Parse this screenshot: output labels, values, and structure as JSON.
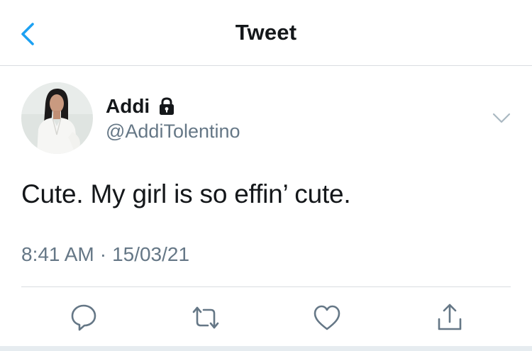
{
  "header": {
    "title": "Tweet",
    "back_icon": "chevron-left-icon"
  },
  "tweet": {
    "author": {
      "display_name": "Addi",
      "handle": "@AddiTolentino",
      "protected_icon": "lock-icon"
    },
    "text": "Cute. My girl is so effin’ cute.",
    "time": "8:41 AM",
    "separator": "·",
    "date": "15/03/21",
    "more_icon": "chevron-down-icon"
  },
  "actions": [
    {
      "name": "reply",
      "icon": "reply-icon"
    },
    {
      "name": "retweet",
      "icon": "retweet-icon"
    },
    {
      "name": "like",
      "icon": "heart-icon"
    },
    {
      "name": "share",
      "icon": "share-icon"
    }
  ],
  "colors": {
    "accent": "#1da1f2",
    "text_primary": "#14171a",
    "text_secondary": "#657786",
    "divider": "#d9dde1",
    "icon_gray": "#657786"
  }
}
